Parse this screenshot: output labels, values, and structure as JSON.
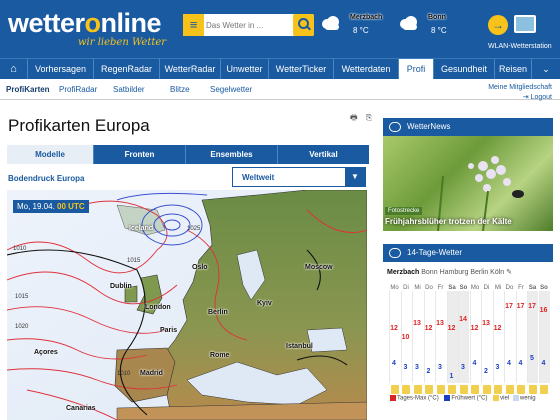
{
  "header": {
    "logo_main": "wetter",
    "logo_o": "o",
    "logo_rest": "nline",
    "tagline": "wir lieben Wetter",
    "search_placeholder": "Das Wetter in ...",
    "weather": [
      {
        "city": "Merzbach",
        "temp": "8 °C"
      },
      {
        "city": "Bonn",
        "temp": "8 °C"
      }
    ],
    "wlan_label": "WLAN-Wetterstation"
  },
  "nav": {
    "items": [
      "Vorhersagen",
      "RegenRadar",
      "WetterRadar",
      "Unwetter",
      "WetterTicker",
      "Wetterdaten",
      "Profi",
      "Gesundheit",
      "Reisen"
    ],
    "active": "Profi"
  },
  "subnav": {
    "items": [
      "ProfiKarten",
      "ProfiRadar",
      "Satbilder",
      "Blitze",
      "Segelwetter"
    ],
    "member_link": "Meine Mitgliedschaft",
    "logout": "Logout"
  },
  "page": {
    "title": "Profikarten Europa",
    "tabs": [
      "Modelle",
      "Fronten",
      "Ensembles",
      "Vertikal"
    ],
    "map_title": "Bodendruck Europa",
    "region_select": "Weltweit",
    "date_day": "Mo, 19.04.",
    "date_time": "00 UTC",
    "cities": [
      "Iceland",
      "Oslo",
      "Moscow",
      "Dublin",
      "London",
      "Berlin",
      "Paris",
      "Kyiv",
      "Rome",
      "Madrid",
      "Istanbul",
      "Açores",
      "Canarias"
    ],
    "isobars": [
      "1015",
      "1010",
      "1020",
      "1025"
    ]
  },
  "news": {
    "title": "WetterNews",
    "tag": "Fotostrecke",
    "headline": "Frühjahrsblüher trotzen der Kälte"
  },
  "trend": {
    "title": "14-Tage-Wetter",
    "active_city": "Merzbach",
    "cities": [
      "Bonn",
      "Hamburg",
      "Berlin",
      "Köln"
    ],
    "days": [
      "Mo",
      "Di",
      "Mi",
      "Do",
      "Fr",
      "Sa",
      "So",
      "Mo",
      "Di",
      "Mi",
      "Do",
      "Fr",
      "Sa",
      "So"
    ],
    "max_temps": [
      12,
      10,
      13,
      12,
      13,
      12,
      14,
      12,
      13,
      12,
      17,
      17,
      17,
      16
    ],
    "min_temps": [
      4,
      3,
      3,
      2,
      3,
      1,
      3,
      4,
      2,
      3,
      4,
      4,
      5,
      4
    ],
    "legend_max": "Tages-Max (°C)",
    "legend_min": "Frühwert (°C)",
    "legend_viel": "viel",
    "legend_wenig": "wenig",
    "colors": {
      "max": "#dd2222",
      "min": "#1a3fc0"
    }
  }
}
